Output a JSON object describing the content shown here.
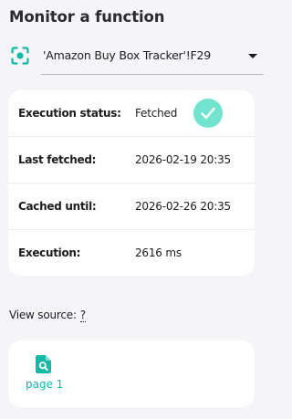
{
  "panel": {
    "title": "Monitor a function"
  },
  "function_selector": {
    "icon": "target-icon",
    "value": "'Amazon Buy Box Tracker'!F29"
  },
  "status": {
    "rows": [
      {
        "label": "Execution status:",
        "value": "Fetched"
      },
      {
        "label": "Last fetched:",
        "value": "2026-02-19 20:35"
      },
      {
        "label": "Cached until:",
        "value": "2026-02-26 20:35"
      },
      {
        "label": "Execution:",
        "value": "2616 ms"
      }
    ],
    "status_icon": "check-circle-icon"
  },
  "source": {
    "label": "View source:",
    "help": "?",
    "pages": [
      {
        "label": "page 1",
        "icon": "page-search-icon"
      }
    ]
  },
  "colors": {
    "accent": "#14b8a6",
    "check_badge": "#72e3cf",
    "background": "#f5f5f7",
    "card": "#ffffff"
  }
}
